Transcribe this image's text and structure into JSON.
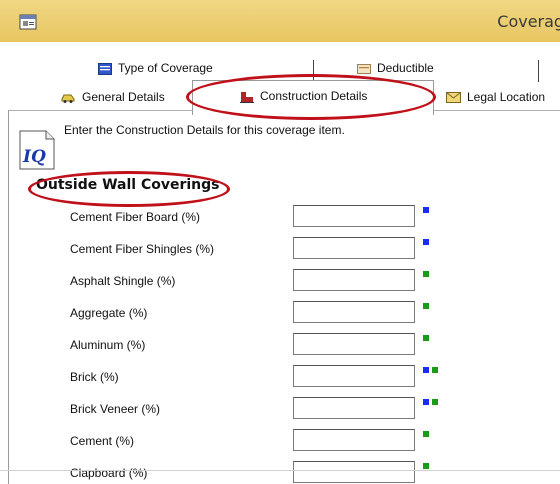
{
  "window": {
    "title": "Coverage It"
  },
  "tabs": {
    "back_row": [
      {
        "label": "Type of Coverage",
        "icon": "coverage-icon"
      },
      {
        "label": "Deductible",
        "icon": "deductible-icon"
      }
    ],
    "front_row": [
      {
        "label": "General Details",
        "icon": "car-icon"
      },
      {
        "label": "Construction Details",
        "icon": "building-icon",
        "active": true
      },
      {
        "label": "Legal Location",
        "icon": "envelope-icon"
      }
    ]
  },
  "content": {
    "description": "Enter the Construction Details for this coverage item.",
    "logo_text": "IQ",
    "section_title": "Outside Wall Coverings",
    "fields": [
      {
        "label": "Cement Fiber Board (%)",
        "value": "",
        "indicators": [
          "blue"
        ]
      },
      {
        "label": "Cement Fiber Shingles (%)",
        "value": "",
        "indicators": [
          "blue"
        ]
      },
      {
        "label": "Asphalt Shingle (%)",
        "value": "",
        "indicators": [
          "green"
        ]
      },
      {
        "label": "Aggregate (%)",
        "value": "",
        "indicators": [
          "green"
        ]
      },
      {
        "label": "Aluminum (%)",
        "value": "",
        "indicators": [
          "green"
        ]
      },
      {
        "label": "Brick (%)",
        "value": "",
        "indicators": [
          "blue",
          "green"
        ]
      },
      {
        "label": "Brick Veneer (%)",
        "value": "",
        "indicators": [
          "blue",
          "green"
        ]
      },
      {
        "label": "Cement (%)",
        "value": "",
        "indicators": [
          "green"
        ]
      },
      {
        "label": "Clapboard (%)",
        "value": "",
        "indicators": [
          "green"
        ]
      }
    ]
  },
  "colors": {
    "title_bar": "#e9ca68",
    "highlight": "#c0101a",
    "blue": "#1a2cff",
    "green": "#1a9a1a"
  }
}
